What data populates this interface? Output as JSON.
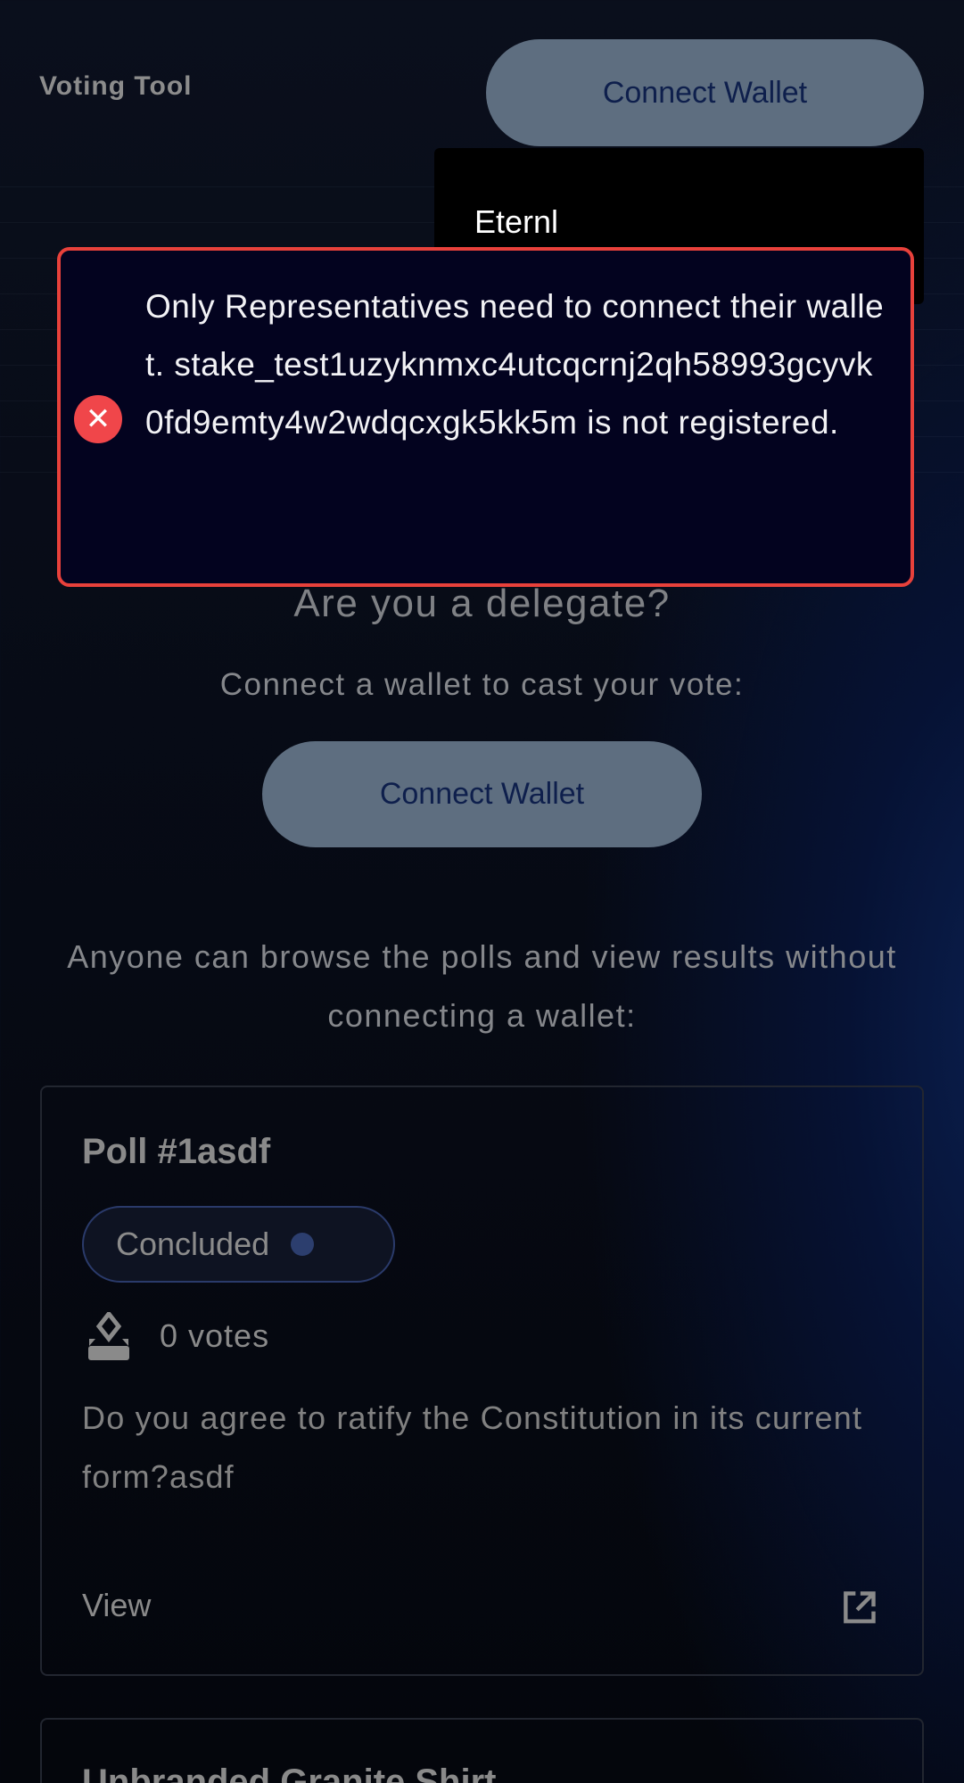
{
  "header": {
    "title": "Voting Tool",
    "connect_label": "Connect Wallet"
  },
  "wallet_dropdown": {
    "items": [
      "Eternl"
    ]
  },
  "toast": {
    "icon": "error-x-icon",
    "color": "#e8413b",
    "message": "Only Representatives need to connect their wallet. stake_test1uzyknmxc4utcqcrnj2qh58993gcyvk0fd9emty4w2wdqcxgk5kk5m is not registered."
  },
  "main": {
    "heading": "Are you a delegate?",
    "subheading": "Connect a wallet to cast your vote:",
    "connect_label": "Connect Wallet",
    "browse_text": "Anyone can browse the polls and view results without connecting a wallet:"
  },
  "polls": [
    {
      "title": "Poll #1asdf",
      "status": "Concluded",
      "votes": "0 votes",
      "description": "Do you agree to ratify the Constitution in its current form?asdf",
      "view_label": "View"
    },
    {
      "title": "Unbranded Granite Shirt"
    }
  ]
}
